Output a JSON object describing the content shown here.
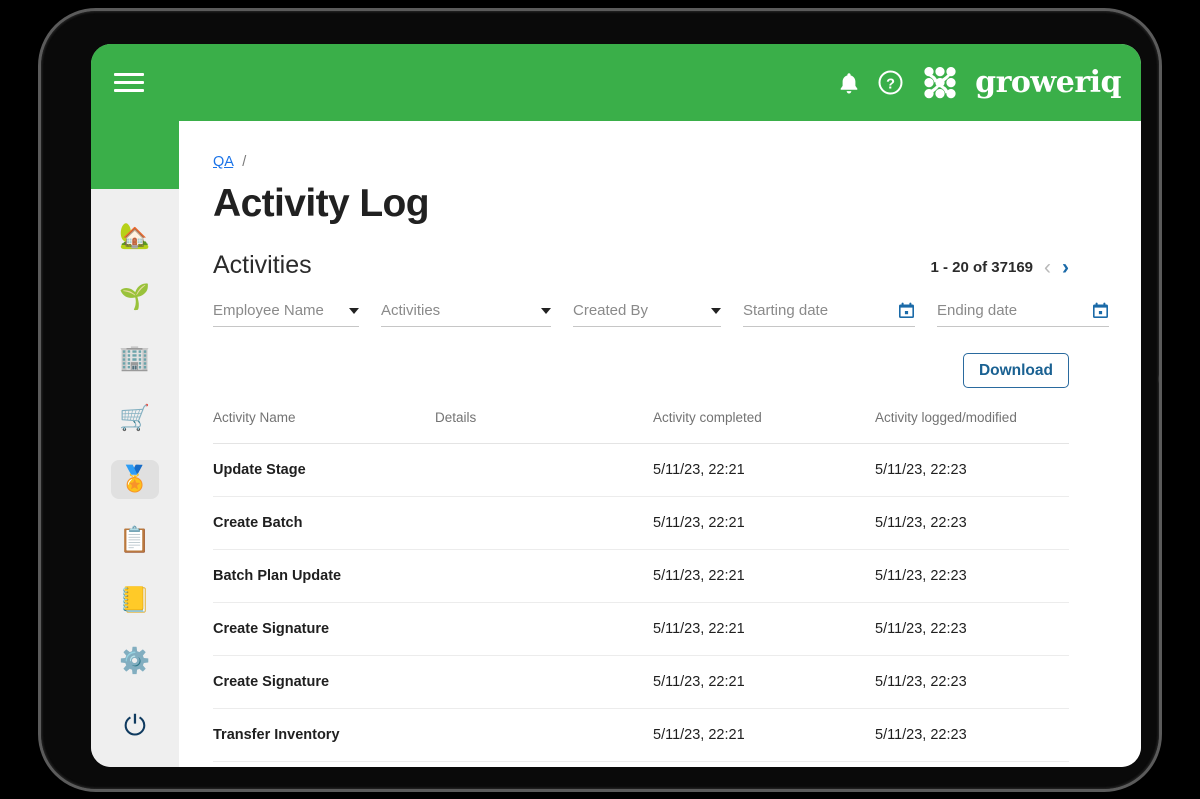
{
  "topbar": {
    "hamburger_icon": "hamburger-menu-icon",
    "bell_icon": "notification-bell-icon",
    "help_icon": "help-circle-icon",
    "brand_mark_icon": "groweriq-logo-mark",
    "brand_name": "groweriq",
    "background_color": "#3aaf49"
  },
  "sidebar": {
    "background_color": "#efefef",
    "items": [
      {
        "icon": "🏡",
        "name": "home",
        "selected": false
      },
      {
        "icon": "🌱",
        "name": "cultivation",
        "selected": false
      },
      {
        "icon": "🏢",
        "name": "employees",
        "selected": false
      },
      {
        "icon": "🛒",
        "name": "inventory",
        "selected": false
      },
      {
        "icon": "🏅",
        "name": "quality",
        "selected": true
      },
      {
        "icon": "📋",
        "name": "reports",
        "selected": false
      },
      {
        "icon": "📒",
        "name": "documents",
        "selected": false
      },
      {
        "icon": "⚙️",
        "name": "settings",
        "selected": false
      }
    ],
    "logout": {
      "icon": "⏻",
      "name": "logout"
    }
  },
  "breadcrumb": {
    "link": "QA",
    "separator": "/"
  },
  "page": {
    "title": "Activity Log",
    "section_title": "Activities"
  },
  "paginator": {
    "range": "1 - 20 of 37169",
    "prev_icon": "‹",
    "next_icon": "›",
    "prev_enabled": false,
    "next_enabled": true,
    "accent_color": "#1a6aa8"
  },
  "filters": [
    {
      "placeholder": "Employee Name",
      "control": "dropdown",
      "name": "employee-name"
    },
    {
      "placeholder": "Activities",
      "control": "dropdown",
      "name": "activities"
    },
    {
      "placeholder": "Created By",
      "control": "dropdown",
      "name": "created-by"
    },
    {
      "placeholder": "Starting date",
      "control": "datepicker",
      "name": "starting-date"
    },
    {
      "placeholder": "Ending date",
      "control": "datepicker",
      "name": "ending-date"
    }
  ],
  "toolbar": {
    "download_label": "Download",
    "download_color": "#1a6192"
  },
  "table": {
    "columns": [
      "Activity Name",
      "Details",
      "Activity completed",
      "Activity logged/modified"
    ],
    "rows": [
      {
        "name": "Update Stage",
        "details": "",
        "completed": "5/11/23, 22:21",
        "modified": "5/11/23, 22:23"
      },
      {
        "name": "Create Batch",
        "details": "",
        "completed": "5/11/23, 22:21",
        "modified": "5/11/23, 22:23"
      },
      {
        "name": "Batch Plan Update",
        "details": "",
        "completed": "5/11/23, 22:21",
        "modified": "5/11/23, 22:23"
      },
      {
        "name": "Create Signature",
        "details": "",
        "completed": "5/11/23, 22:21",
        "modified": "5/11/23, 22:23"
      },
      {
        "name": "Create Signature",
        "details": "",
        "completed": "5/11/23, 22:21",
        "modified": "5/11/23, 22:23"
      },
      {
        "name": "Transfer Inventory",
        "details": "",
        "completed": "5/11/23, 22:21",
        "modified": "5/11/23, 22:23"
      }
    ]
  }
}
